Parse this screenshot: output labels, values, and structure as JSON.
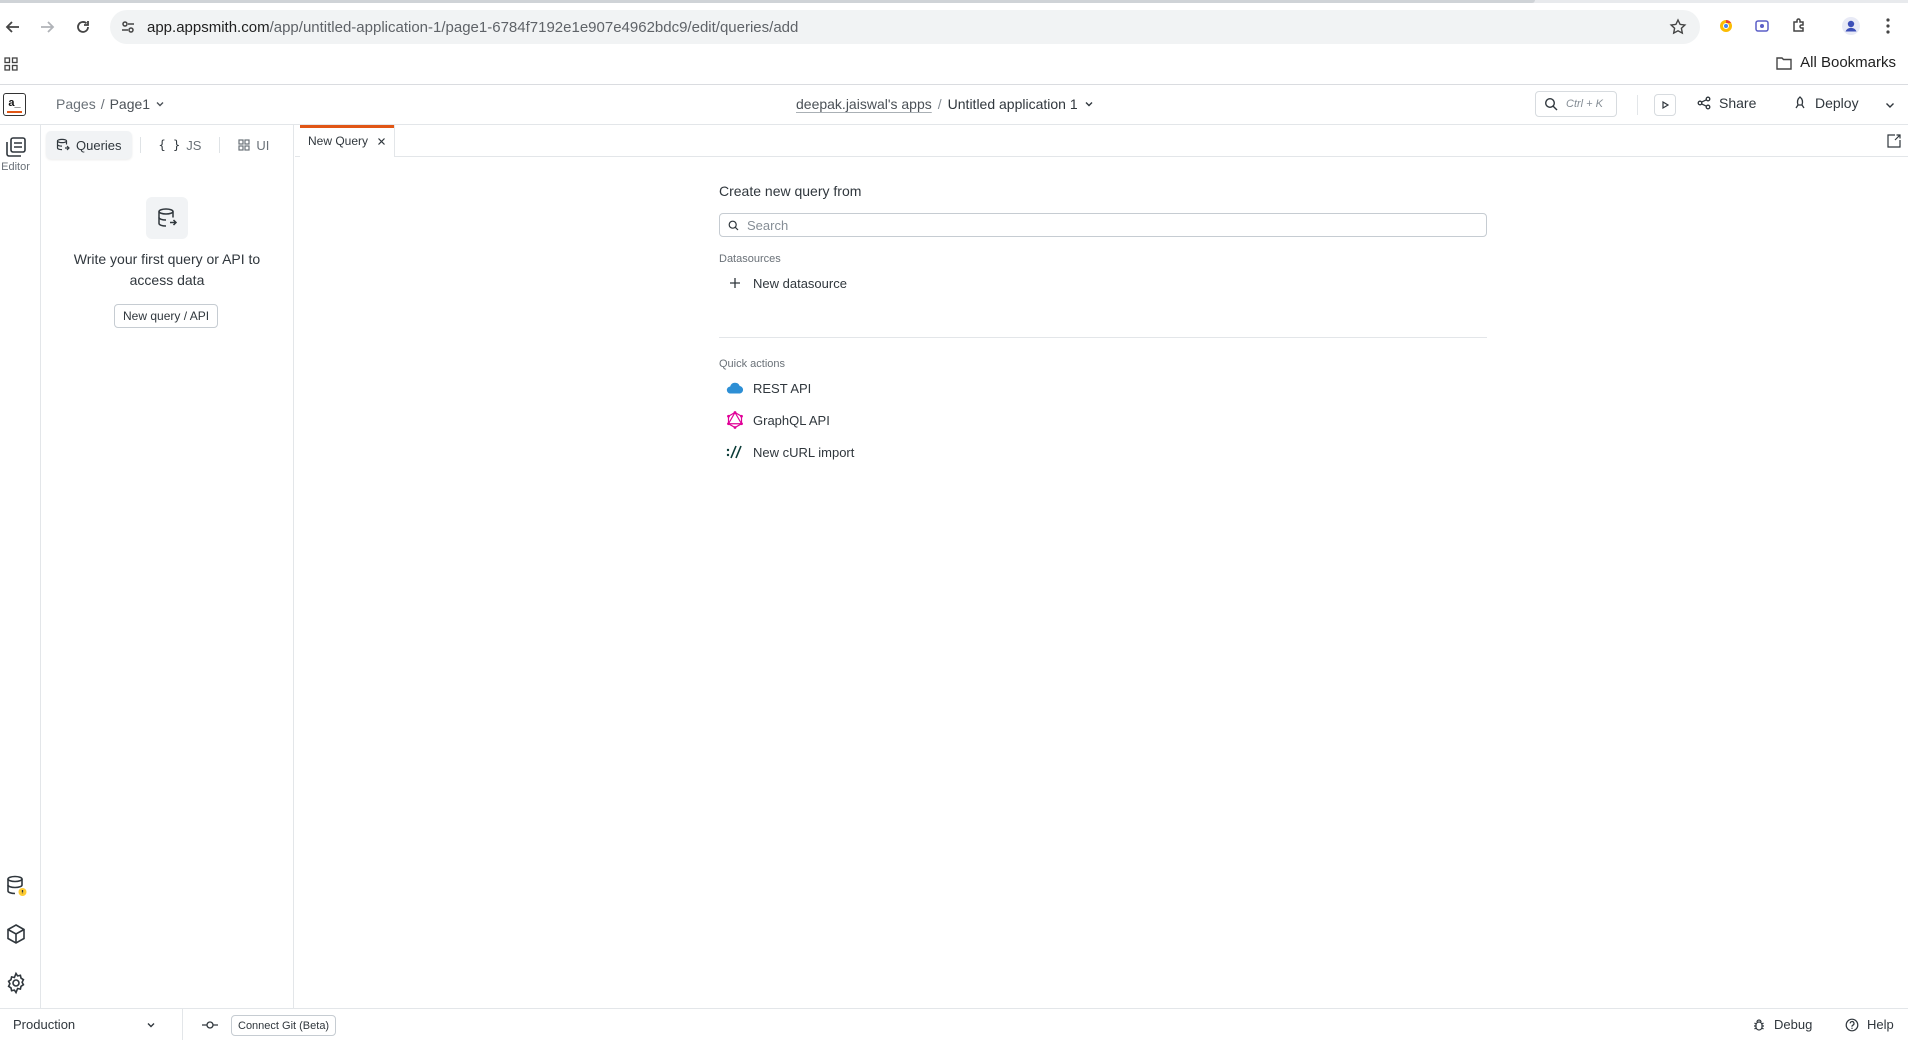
{
  "browser": {
    "url_host": "app.appsmith.com",
    "url_path": "/app/untitled-application-1/page1-6784f7192e1e907e4962bdc9/edit/queries/add",
    "bookmarks_label": "All Bookmarks"
  },
  "header": {
    "logo_text": "a_",
    "breadcrumb_root": "Pages",
    "breadcrumb_sep": "/",
    "breadcrumb_page": "Page1",
    "workspace": "deepak.jaiswal's apps",
    "title_sep": "/",
    "app_name": "Untitled application 1",
    "search_shortcut": "Ctrl + K",
    "share_label": "Share",
    "deploy_label": "Deploy"
  },
  "left_rail": {
    "editor_label": "Editor",
    "items": [
      {
        "icon": "editor-icon",
        "label": "Editor",
        "active": true
      },
      {
        "icon": "datasource-icon"
      },
      {
        "icon": "package-icon"
      },
      {
        "icon": "settings-gear-icon"
      }
    ]
  },
  "explorer": {
    "tabs": [
      {
        "label": "Queries",
        "icon": "queries-icon",
        "active": true
      },
      {
        "label": "JS",
        "icon": "js-braces-icon",
        "active": false
      },
      {
        "label": "UI",
        "icon": "ui-grid-icon",
        "active": false
      }
    ],
    "empty_text": "Write your first query or API to access data",
    "new_query_button": "New query / API"
  },
  "editor_tabs": [
    {
      "label": "New Query",
      "active": true,
      "closable": true
    }
  ],
  "main": {
    "title": "Create new query from",
    "search_placeholder": "Search",
    "datasources_label": "Datasources",
    "new_datasource_label": "New datasource",
    "quick_actions_label": "Quick actions",
    "quick_actions": [
      {
        "label": "REST API",
        "icon": "cloud-icon"
      },
      {
        "label": "GraphQL API",
        "icon": "graphql-icon"
      },
      {
        "label": "New cURL import",
        "icon": "curl-icon"
      }
    ]
  },
  "bottom_bar": {
    "environment": "Production",
    "connect_git": "Connect Git (Beta)",
    "debug": "Debug",
    "help": "Help"
  },
  "colors": {
    "accent": "#e15615",
    "graphql": "#e10098",
    "cloud": "#2d8fd5"
  }
}
